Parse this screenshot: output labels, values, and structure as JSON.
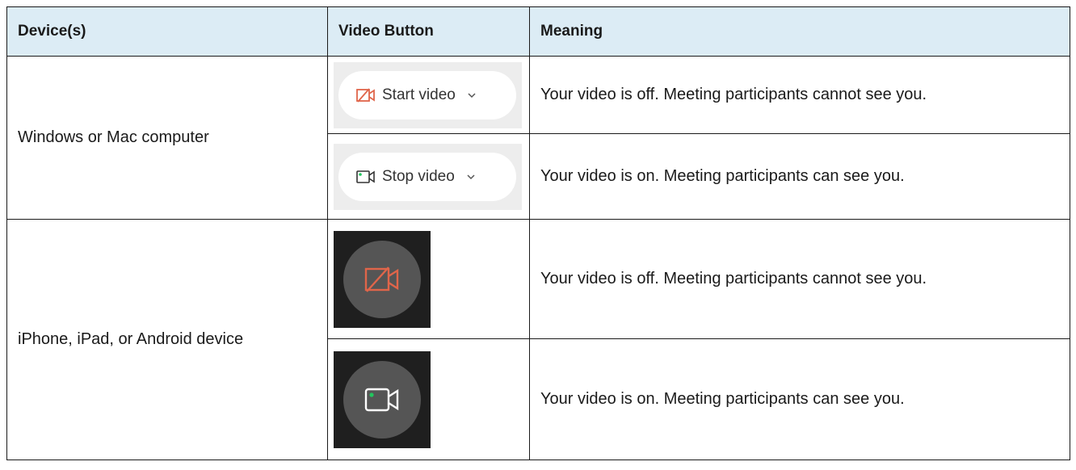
{
  "table": {
    "headers": [
      "Device(s)",
      "Video Button",
      "Meaning"
    ],
    "devices": {
      "desktop": "Windows or Mac computer",
      "mobile": "iPhone, iPad, or Android device"
    },
    "rows": [
      {
        "button_label": "Start video",
        "button_icon": "video-off-icon",
        "meaning": "Your video is off. Meeting participants cannot see you."
      },
      {
        "button_label": "Stop video",
        "button_icon": "video-on-icon",
        "meaning": "Your video is on. Meeting participants can see you."
      },
      {
        "button_label": "",
        "button_icon": "video-off-icon",
        "meaning": "Your video is off. Meeting participants cannot see you."
      },
      {
        "button_label": "",
        "button_icon": "video-on-icon",
        "meaning": "Your video is on. Meeting participants can see you."
      }
    ]
  },
  "colors": {
    "header_bg": "#dcecf5",
    "off_icon": "#e0654a",
    "on_dot": "#22c55e",
    "mobile_bg": "#1f1f1f",
    "mobile_circle": "#555555"
  }
}
